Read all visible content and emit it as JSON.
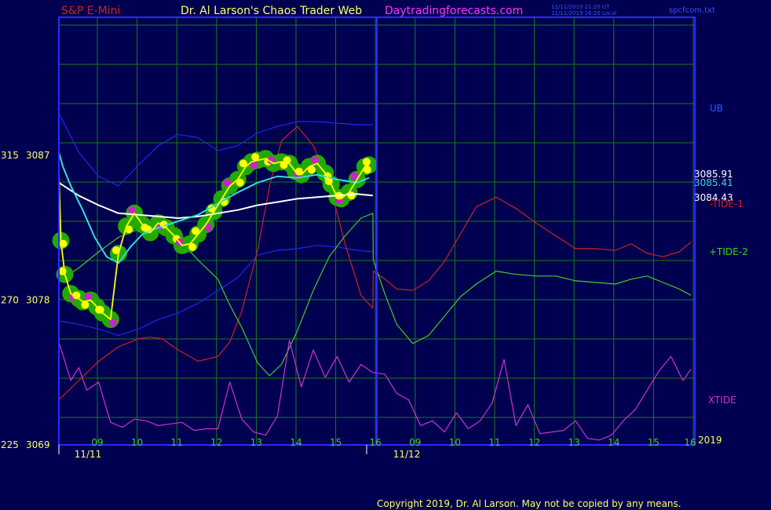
{
  "header": {
    "symbol": "S&P E-Mini",
    "author": "Dr. Al Larson's Chaos Trader Web",
    "site": "Daytradingforecasts.com",
    "time_ut": "11/11/2019 21:20  UT",
    "time_local": "11/11/2019 16:20  Local",
    "file": "spcfcom.txt"
  },
  "footer": {
    "copyright": "Copyright 2019, Dr. Al Larson. May not be copied by any means."
  },
  "colors": {
    "background": "#000050",
    "grid": "#1a7a1a",
    "frame": "#2a2aff",
    "price": "#ffff00",
    "highlight_green": "#22aa00",
    "highlight_magenta": "#cc22cc",
    "cyan_avg": "#33dddd",
    "white_avg": "#ffffff",
    "band": "#1a2aee",
    "tide1": "#cc2222",
    "tide2": "#44cc22",
    "xtide": "#cc33cc"
  },
  "chart_data": {
    "type": "line",
    "y_axis_left": [
      {
        "label": "315",
        "value": "3087"
      },
      {
        "label": "270",
        "value": "3078"
      },
      {
        "label": "225",
        "value": "3069"
      }
    ],
    "ylim": [
      3069,
      3087
    ],
    "x_ticks": [
      "09",
      "10",
      "11",
      "12",
      "13",
      "14",
      "15",
      "16",
      "09",
      "10",
      "11",
      "12",
      "13",
      "14",
      "15",
      "16"
    ],
    "dates": [
      {
        "label": "11/11",
        "index": 0
      },
      {
        "label": "11/12",
        "index": 8
      }
    ],
    "year_label": "2019",
    "price_readouts": [
      {
        "value": "3085.91",
        "color": "#ffffff"
      },
      {
        "value": "3085.41",
        "color": "#33dddd"
      },
      {
        "value": "3084.43",
        "color": "#ffffff"
      }
    ],
    "right_labels": [
      "UB",
      "-TIDE-1",
      "+TIDE-2",
      "XTIDE"
    ],
    "series": [
      {
        "key": "price",
        "color": "#ffff00",
        "x": [
          0,
          0.05,
          0.15,
          0.3,
          0.5,
          0.6,
          0.8,
          0.95,
          1.1,
          1.3,
          1.5,
          1.7,
          1.9,
          2.1,
          2.3,
          2.5,
          2.7,
          2.9,
          3.1,
          3.3,
          3.5,
          3.7,
          3.9,
          4.1,
          4.3,
          4.5,
          4.7,
          4.85,
          5.0,
          5.2,
          5.4,
          5.6,
          5.8,
          5.95,
          6.1,
          6.3,
          6.5,
          6.7,
          6.85,
          7.0,
          7.1,
          7.3,
          7.5,
          7.7,
          7.8
        ],
        "values": [
          3086.0,
          3081.7,
          3079.6,
          3078.4,
          3078.1,
          3077.9,
          3078.0,
          3077.6,
          3077.2,
          3076.8,
          3080.9,
          3082.6,
          3083.4,
          3082.7,
          3082.2,
          3082.8,
          3082.5,
          3082.0,
          3081.4,
          3081.5,
          3082.1,
          3082.7,
          3083.5,
          3084.3,
          3085.1,
          3085.5,
          3086.3,
          3086.6,
          3086.7,
          3086.8,
          3086.5,
          3086.6,
          3086.5,
          3086.0,
          3085.8,
          3086.3,
          3086.5,
          3085.9,
          3085.2,
          3084.4,
          3084.3,
          3084.7,
          3085.5,
          3086.3,
          3086.4
        ]
      },
      {
        "key": "cyan_avg",
        "color": "#33dddd",
        "x": [
          0,
          0.1,
          0.3,
          0.6,
          0.9,
          1.2,
          1.5,
          1.8,
          2.1,
          2.5,
          3.0,
          3.5,
          4.0,
          4.5,
          5.0,
          5.5,
          6.0,
          6.5,
          7.0,
          7.5,
          7.8
        ],
        "values": [
          3087.2,
          3086.3,
          3085.1,
          3083.6,
          3081.9,
          3080.7,
          3080.3,
          3081.3,
          3082.1,
          3082.5,
          3082.9,
          3083.3,
          3084.0,
          3084.7,
          3085.3,
          3085.7,
          3085.6,
          3085.8,
          3085.5,
          3085.3,
          3085.6
        ]
      },
      {
        "key": "white_avg",
        "color": "#ffffff",
        "x": [
          0,
          0.5,
          1.0,
          1.5,
          2.0,
          2.5,
          3.0,
          3.5,
          4.0,
          4.5,
          5.0,
          5.5,
          6.0,
          6.5,
          7.0,
          7.5,
          7.9
        ],
        "values": [
          3085.3,
          3084.5,
          3083.9,
          3083.4,
          3083.3,
          3083.2,
          3083.1,
          3083.2,
          3083.4,
          3083.6,
          3083.9,
          3084.1,
          3084.3,
          3084.4,
          3084.5,
          3084.6,
          3084.5
        ]
      },
      {
        "key": "upper_band",
        "color": "#1a2aee",
        "x": [
          0,
          0.5,
          1.0,
          1.5,
          2.0,
          2.5,
          3.0,
          3.5,
          4.0,
          4.5,
          5.0,
          5.5,
          6.0,
          6.5,
          7.0,
          7.5,
          7.9
        ],
        "values": [
          3089.6,
          3087.2,
          3085.7,
          3085.1,
          3086.4,
          3087.6,
          3088.3,
          3088.1,
          3087.3,
          3087.6,
          3088.4,
          3088.8,
          3089.1,
          3089.1,
          3089.0,
          3088.9,
          3088.9
        ]
      },
      {
        "key": "lower_band",
        "color": "#1a2aee",
        "x": [
          0,
          0.5,
          1.0,
          1.5,
          2.0,
          2.5,
          3.0,
          3.5,
          4.0,
          4.5,
          5.0,
          5.5,
          6.0,
          6.5,
          7.0,
          7.5,
          7.9
        ],
        "values": [
          3076.7,
          3076.5,
          3076.2,
          3075.8,
          3076.2,
          3076.8,
          3077.2,
          3077.8,
          3078.6,
          3079.4,
          3080.8,
          3081.1,
          3081.2,
          3081.4,
          3081.3,
          3081.1,
          3081.0
        ]
      },
      {
        "key": "tide1",
        "color": "#cc2222",
        "x": [
          0,
          0.5,
          1.0,
          1.5,
          2.0,
          2.3,
          2.6,
          3.0,
          3.5,
          4.0,
          4.3,
          4.6,
          5.0,
          5.3,
          5.6,
          6.0,
          6.4,
          6.8,
          7.2,
          7.6,
          7.9,
          7.91,
          8.2,
          8.5,
          8.9,
          9.3,
          9.7,
          10.1,
          10.5,
          11.0,
          11.5,
          12.0,
          12.5,
          13.0,
          13.5,
          14.0,
          14.4,
          14.8,
          15.2,
          15.6,
          15.9
        ],
        "values": [
          3071.8,
          3073.0,
          3074.2,
          3075.1,
          3075.6,
          3075.7,
          3075.6,
          3074.9,
          3074.2,
          3074.5,
          3075.4,
          3077.3,
          3081.1,
          3085.1,
          3087.9,
          3088.8,
          3087.6,
          3085.3,
          3081.5,
          3078.3,
          3077.5,
          3079.8,
          3079.3,
          3078.7,
          3078.6,
          3079.2,
          3080.4,
          3082.1,
          3083.8,
          3084.4,
          3083.7,
          3082.8,
          3082.0,
          3081.2,
          3081.2,
          3081.1,
          3081.5,
          3080.9,
          3080.7,
          3081.0,
          3081.6
        ]
      },
      {
        "key": "tide2",
        "color": "#44cc22",
        "x": [
          0,
          0.5,
          1.0,
          1.5,
          2.0,
          2.3,
          2.6,
          3.0,
          3.5,
          4.0,
          4.3,
          4.6,
          5.0,
          5.3,
          5.6,
          6.0,
          6.4,
          6.8,
          7.2,
          7.6,
          7.9,
          7.91,
          8.2,
          8.5,
          8.9,
          9.3,
          9.7,
          10.1,
          10.5,
          11.0,
          11.5,
          12.0,
          12.5,
          13.0,
          13.5,
          14.0,
          14.4,
          14.8,
          15.2,
          15.6,
          15.9
        ],
        "values": [
          3079.2,
          3080.0,
          3081.0,
          3081.9,
          3082.4,
          3082.4,
          3082.2,
          3081.8,
          3080.5,
          3079.3,
          3077.7,
          3076.3,
          3074.1,
          3073.3,
          3074.0,
          3076.1,
          3078.6,
          3080.7,
          3082.0,
          3083.1,
          3083.4,
          3080.5,
          3078.4,
          3076.5,
          3075.3,
          3075.8,
          3077.0,
          3078.2,
          3079.0,
          3079.8,
          3079.6,
          3079.5,
          3079.5,
          3079.2,
          3079.1,
          3079.0,
          3079.3,
          3079.5,
          3079.1,
          3078.7,
          3078.3
        ]
      },
      {
        "key": "xtide",
        "color": "#cc33cc",
        "x": [
          0,
          0.3,
          0.5,
          0.7,
          1.0,
          1.3,
          1.6,
          1.9,
          2.2,
          2.5,
          2.8,
          3.1,
          3.4,
          3.7,
          4.0,
          4.3,
          4.6,
          4.9,
          5.2,
          5.5,
          5.8,
          6.1,
          6.4,
          6.7,
          7.0,
          7.3,
          7.6,
          7.9,
          8.2,
          8.5,
          8.8,
          9.1,
          9.4,
          9.7,
          10.0,
          10.3,
          10.6,
          10.9,
          11.2,
          11.5,
          11.8,
          12.1,
          12.4,
          12.7,
          13.0,
          13.3,
          13.6,
          13.9,
          14.2,
          14.5,
          14.8,
          15.1,
          15.4,
          15.7,
          15.9
        ],
        "values": [
          3075.4,
          3073.0,
          3073.8,
          3072.4,
          3072.9,
          3070.4,
          3070.1,
          3070.6,
          3070.5,
          3070.2,
          3070.3,
          3070.4,
          3069.9,
          3070.0,
          3070.0,
          3072.9,
          3070.6,
          3069.8,
          3069.6,
          3070.8,
          3075.5,
          3072.6,
          3074.9,
          3073.2,
          3074.5,
          3072.9,
          3074.0,
          3073.5,
          3073.4,
          3072.2,
          3071.8,
          3070.2,
          3070.5,
          3069.8,
          3071.0,
          3070.0,
          3070.5,
          3071.6,
          3074.3,
          3070.2,
          3071.5,
          3069.7,
          3069.8,
          3069.9,
          3070.5,
          3069.4,
          3069.3,
          3069.6,
          3070.5,
          3071.2,
          3072.4,
          3073.6,
          3074.5,
          3073.0,
          3073.7
        ]
      }
    ]
  }
}
